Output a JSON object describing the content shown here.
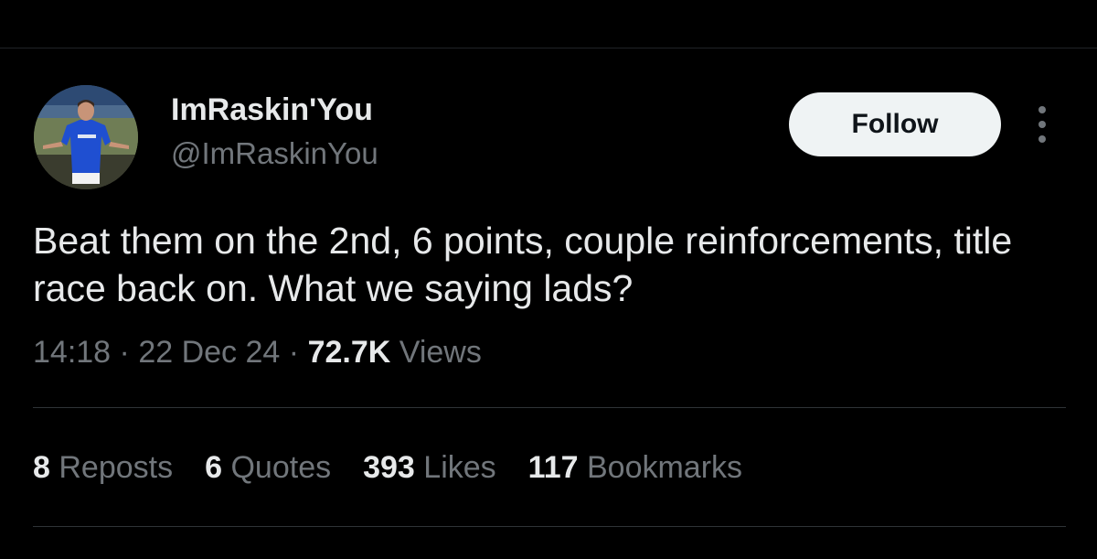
{
  "author": {
    "display_name": "ImRaskin'You",
    "handle": "@ImRaskinYou",
    "avatar_icon": "avatar-photo"
  },
  "follow_label": "Follow",
  "more_icon": "more-vertical-icon",
  "tweet": {
    "text": "Beat them on the 2nd, 6 points, couple reinforcements, title race back on. What we saying lads?"
  },
  "meta": {
    "time": "14:18",
    "separator": "·",
    "date": "22 Dec 24",
    "views_count": "72.7K",
    "views_label": "Views"
  },
  "stats": [
    {
      "count": "8",
      "label": "Reposts"
    },
    {
      "count": "6",
      "label": "Quotes"
    },
    {
      "count": "393",
      "label": "Likes"
    },
    {
      "count": "117",
      "label": "Bookmarks"
    }
  ],
  "colors": {
    "background": "#000000",
    "primary_text": "#e7e9ea",
    "secondary_text": "#71767b",
    "follow_bg": "#eff3f4",
    "divider": "#2f3336"
  }
}
